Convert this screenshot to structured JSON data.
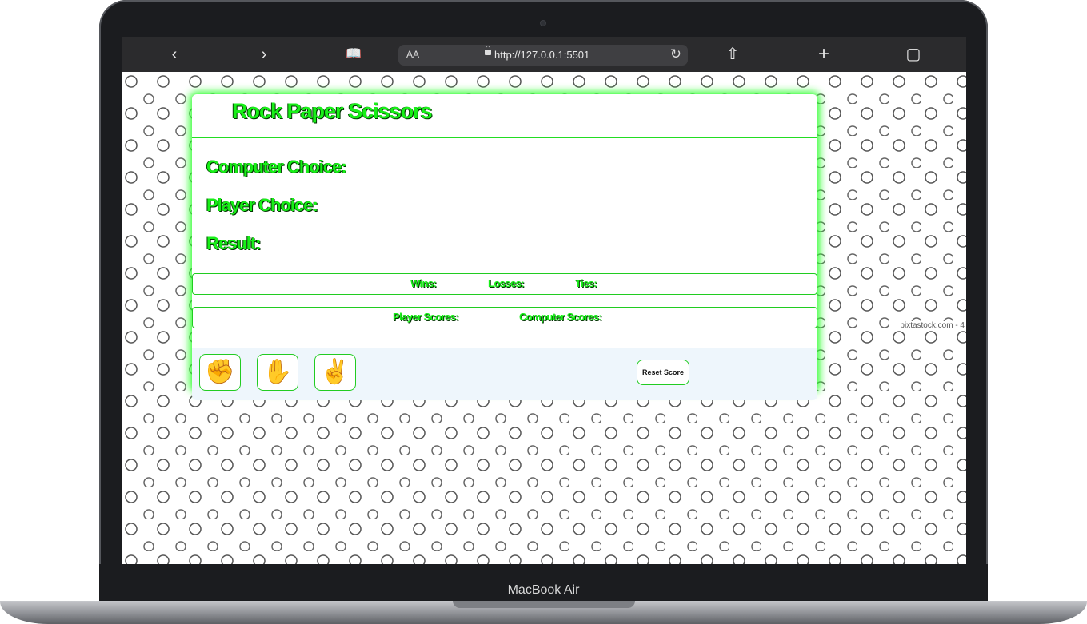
{
  "device": {
    "label": "MacBook Air"
  },
  "browser": {
    "url": "http://127.0.0.1:5501",
    "text_size_label": "AA",
    "icons": {
      "back": "‹",
      "forward": "›",
      "reader": "📖",
      "share": "⇧",
      "new_tab": "+",
      "tabs": "▢",
      "reload": "↻"
    }
  },
  "page": {
    "watermark": "pixtastock.com - 4",
    "title": "Rock Paper Scissors",
    "computer_choice_label": "Computer Choice:",
    "player_choice_label": "Player Choice:",
    "result_label": "Result:",
    "wins_label": "Wins:",
    "losses_label": "Losses:",
    "ties_label": "Ties:",
    "player_scores_label": "Player Scores:",
    "computer_scores_label": "Computer Scores:",
    "choices": [
      {
        "name": "rock",
        "emoji": "✊"
      },
      {
        "name": "paper",
        "emoji": "✋"
      },
      {
        "name": "scissors",
        "emoji": "✌️"
      }
    ],
    "reset_label": "Reset Score",
    "accent_color": "#18ef18"
  }
}
